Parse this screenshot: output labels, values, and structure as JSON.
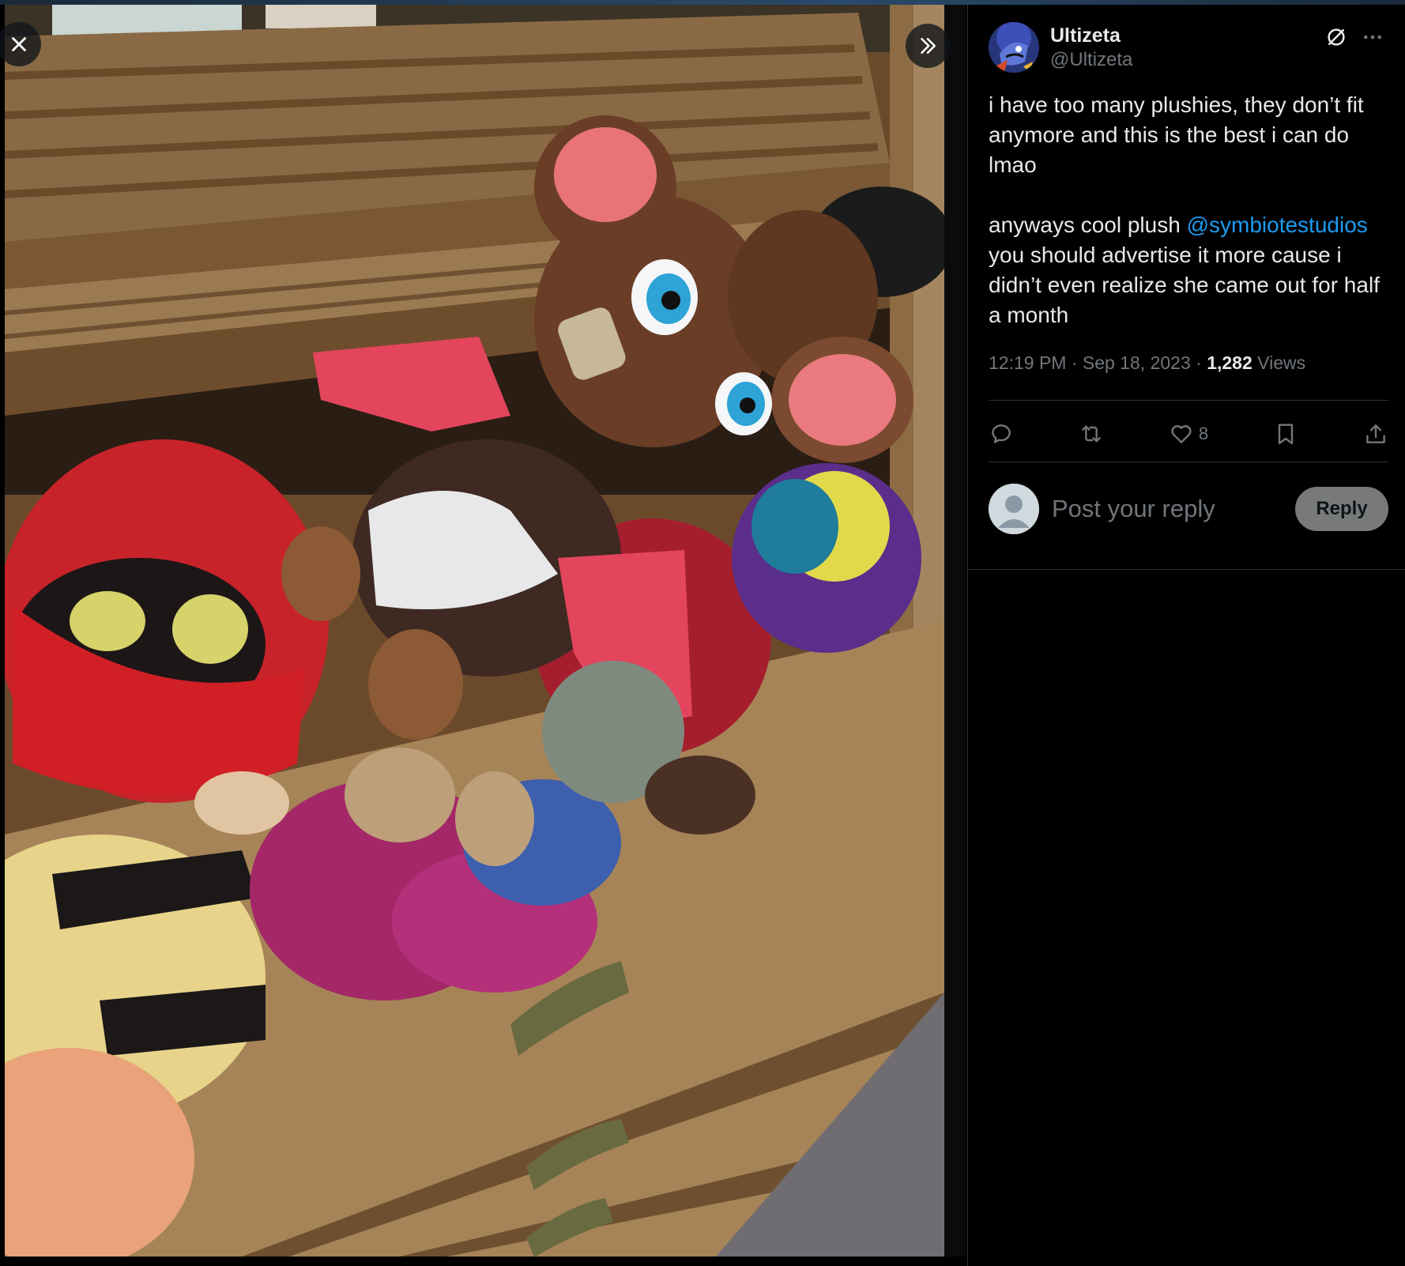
{
  "tweet": {
    "display_name": "Ultizeta",
    "handle": "@Ultizeta",
    "text_line1": "i have too many plushies, they don’t fit anymore and this is the best i can do lmao\n\nanyways cool plush ",
    "mention": "@symbiotestudios",
    "text_line2": "\nyou should advertise it more cause i didn’t even realize she came out for half a month",
    "time": "12:19 PM",
    "date": "Sep 18, 2023",
    "views_count": "1,282",
    "views_label": "Views",
    "likes_count": "8"
  },
  "reply": {
    "placeholder": "Post your reply",
    "button_label": "Reply"
  },
  "icons": {
    "close": "close-icon",
    "expand": "chevrons-right-icon",
    "grok": "grok-icon",
    "more": "more-icon",
    "reply": "reply-icon",
    "repost": "repost-icon",
    "like": "heart-icon",
    "bookmark": "bookmark-icon",
    "share": "share-icon"
  },
  "colors": {
    "background": "#000000",
    "text": "#e7e9ea",
    "secondary": "#71767b",
    "link": "#1d9bf0",
    "divider": "#2f3336",
    "reply_button": "#787a7a"
  }
}
